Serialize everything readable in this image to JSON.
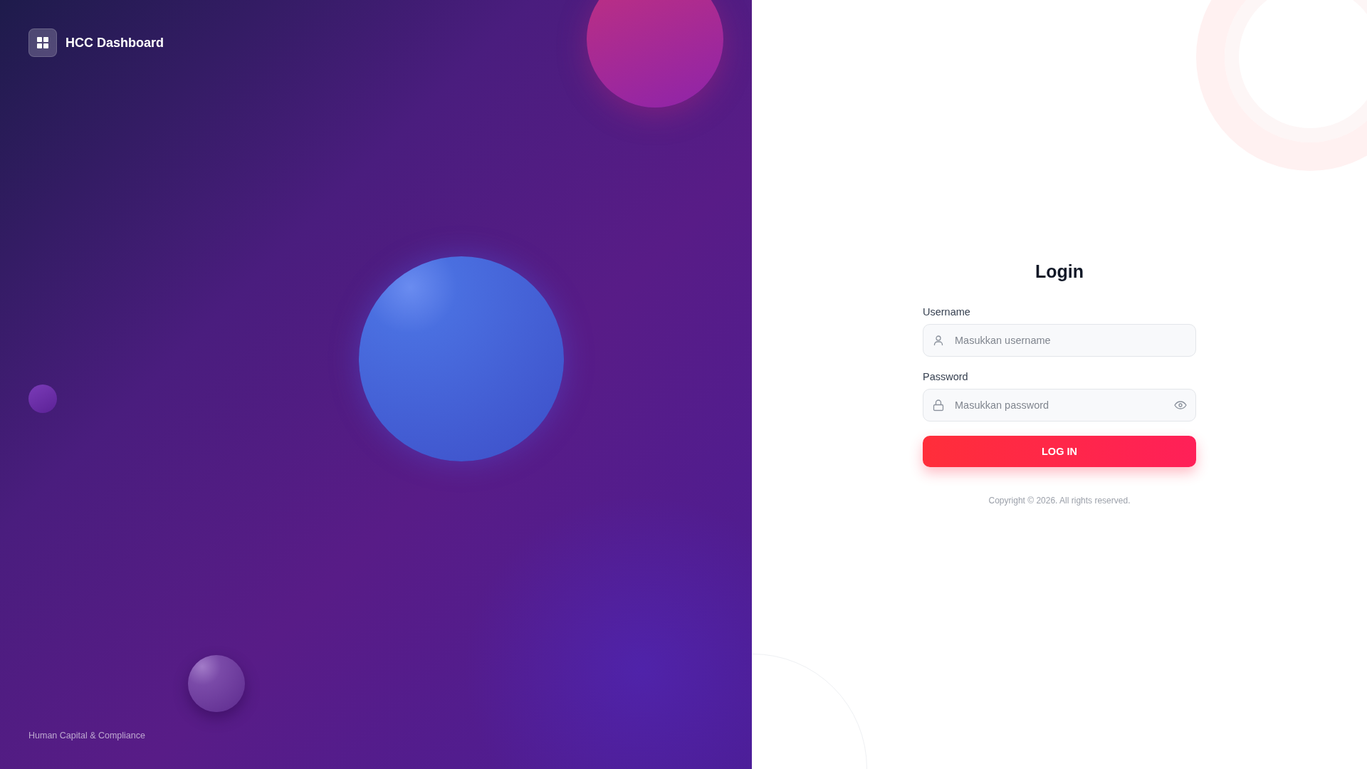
{
  "brand": {
    "name": "HCC Dashboard",
    "tagline": "Human Capital & Compliance"
  },
  "login": {
    "title": "Login",
    "fields": [
      {
        "kind": "text",
        "label": "Username",
        "placeholder": "Masukkan username"
      },
      {
        "kind": "password",
        "label": "Password",
        "placeholder": "Masukkan password"
      }
    ],
    "button": "LOG IN",
    "copyright": "Copyright © 2026. All rights reserved."
  }
}
